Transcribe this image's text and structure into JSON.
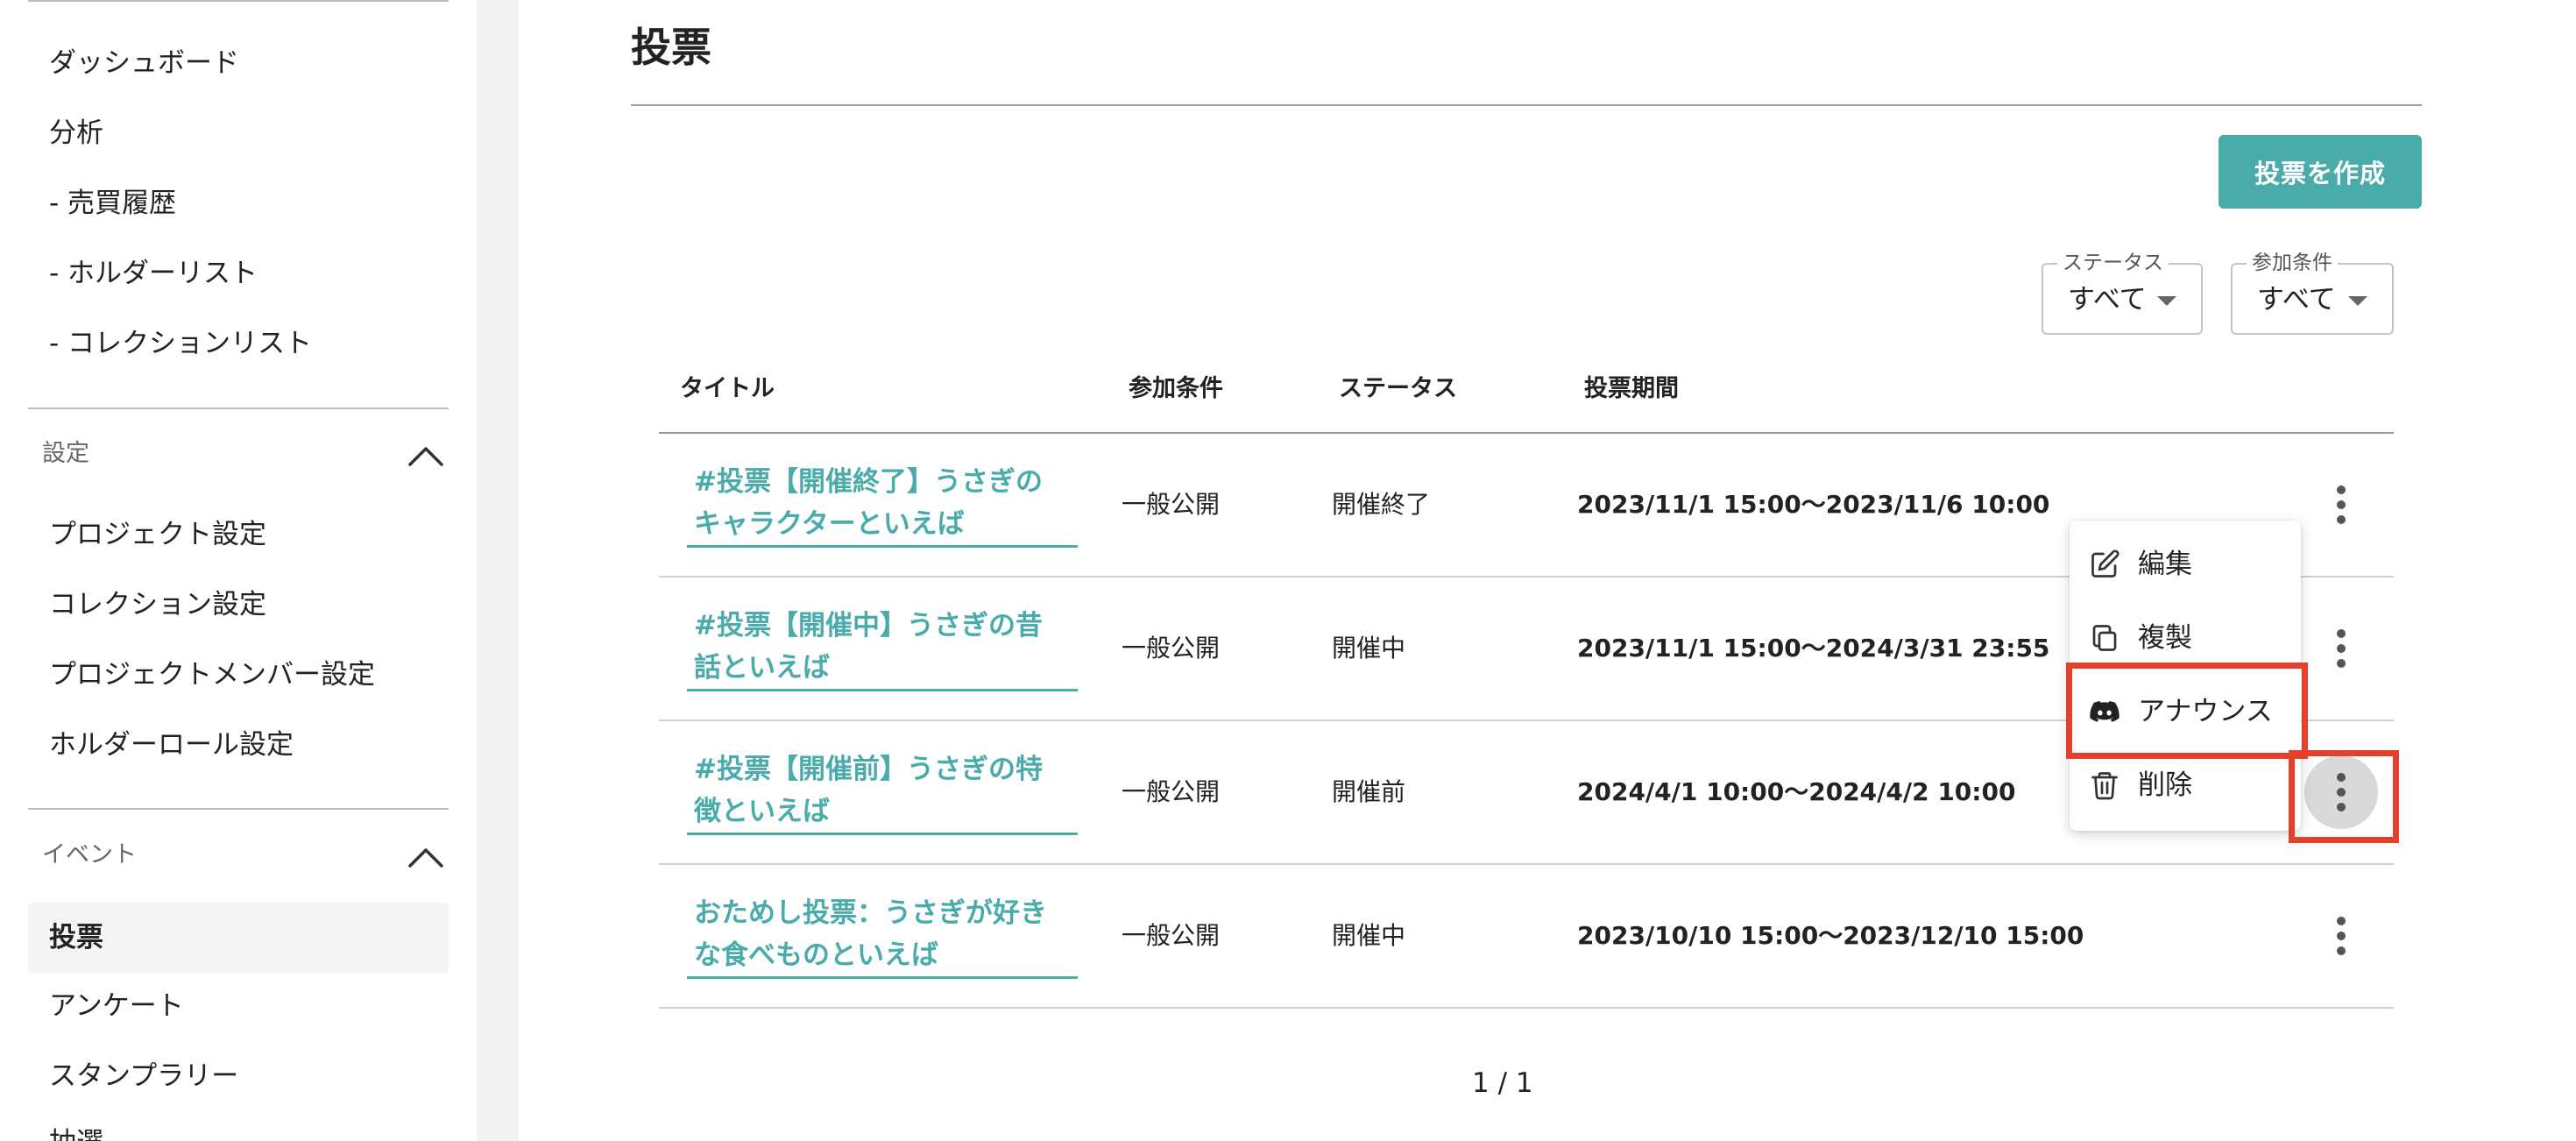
{
  "sidebar": {
    "items": [
      {
        "label": "ダッシュボード"
      },
      {
        "label": "分析"
      },
      {
        "label": "- 売買履歴"
      },
      {
        "label": "- ホルダーリスト"
      },
      {
        "label": "- コレクションリスト"
      }
    ],
    "settings": {
      "section_label": "設定",
      "items": [
        {
          "label": "プロジェクト設定"
        },
        {
          "label": "コレクション設定"
        },
        {
          "label": "プロジェクトメンバー設定"
        },
        {
          "label": "ホルダーロール設定"
        }
      ]
    },
    "events": {
      "section_label": "イベント",
      "items": [
        {
          "label": "投票",
          "active": true
        },
        {
          "label": "アンケート"
        },
        {
          "label": "スタンプラリー"
        },
        {
          "label": "抽選"
        }
      ]
    }
  },
  "page": {
    "title": "投票",
    "create_button": "投票を作成"
  },
  "filters": {
    "status": {
      "label": "ステータス",
      "value": "すべて"
    },
    "condition": {
      "label": "参加条件",
      "value": "すべて"
    }
  },
  "table": {
    "headers": [
      "タイトル",
      "参加条件",
      "ステータス",
      "投票期間"
    ],
    "rows": [
      {
        "title_line1": "#投票【開催終了】うさぎの",
        "title_line2": "キャラクターといえば",
        "condition": "一般公開",
        "status": "開催終了",
        "period": "2023/11/1 15:00〜2023/11/6 10:00"
      },
      {
        "title_line1": "#投票【開催中】うさぎの昔",
        "title_line2": "話といえば",
        "condition": "一般公開",
        "status": "開催中",
        "period": "2023/11/1 15:00〜2024/3/31 23:55"
      },
      {
        "title_line1": "#投票【開催前】うさぎの特",
        "title_line2": "徴といえば",
        "condition": "一般公開",
        "status": "開催前",
        "period": "2024/4/1 10:00〜2024/4/2 10:00"
      },
      {
        "title_line1": "おためし投票：うさぎが好き",
        "title_line2": "な食べものといえば",
        "condition": "一般公開",
        "status": "開催中",
        "period": "2023/10/10 15:00〜2023/12/10 15:00"
      }
    ]
  },
  "pagination": {
    "text": "1 / 1"
  },
  "context_menu": {
    "items": [
      {
        "label": "編集",
        "icon": "edit-icon"
      },
      {
        "label": "複製",
        "icon": "copy-icon"
      },
      {
        "label": "アナウンス",
        "icon": "discord-icon"
      },
      {
        "label": "削除",
        "icon": "trash-icon"
      }
    ]
  },
  "colors": {
    "accent": "#4aabab",
    "highlight": "#e5402b"
  }
}
